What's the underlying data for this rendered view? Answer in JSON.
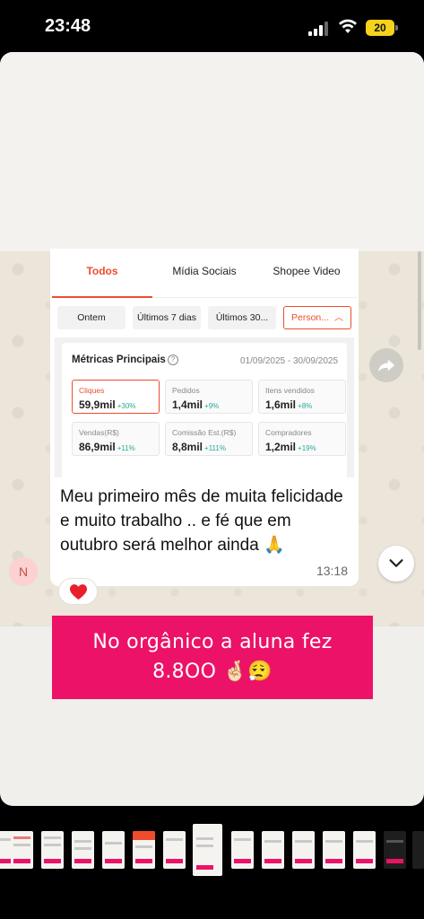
{
  "status_bar": {
    "time": "23:48",
    "battery": "20"
  },
  "shopee": {
    "tabs": [
      "Todos",
      "Mídia Sociais",
      "Shopee Video"
    ],
    "filters": [
      "Ontem",
      "Últimos 7 dias",
      "Últimos 30...",
      "Person..."
    ],
    "metrics_title": "Métricas Principais",
    "date_range": "01/09/2025 - 30/09/2025",
    "metrics": [
      {
        "label": "Cliques",
        "value": "59,9mil",
        "change": "+30%"
      },
      {
        "label": "Pedidos",
        "value": "1,4mil",
        "change": "+9%"
      },
      {
        "label": "Itens vendidos",
        "value": "1,6mil",
        "change": "+8%"
      },
      {
        "label": "Vendas(R$)",
        "value": "86,9mil",
        "change": "+11%"
      },
      {
        "label": "Comissão Est.(R$)",
        "value": "8,8mil",
        "change": "+111%"
      },
      {
        "label": "Compradores",
        "value": "1,2mil",
        "change": "+19%"
      }
    ]
  },
  "message": {
    "text": "Meu primeiro mês de muita felicidade e muito trabalho  .. e fé que em outubro será melhor ainda 🙏",
    "time": "13:18",
    "avatar_initial": "N",
    "reaction": "❤️"
  },
  "caption": {
    "line1": "No orgânico a aluna fez",
    "line2": "8.8OO 🤞🏻😮‍💨"
  },
  "colors": {
    "shopee_orange": "#ee4d2d",
    "caption_pink": "#ec1267",
    "positive_green": "#26aa99"
  },
  "icons": [
    "signal-icon",
    "wifi-icon",
    "battery-icon",
    "help-icon",
    "chevron-up-icon",
    "forward-icon",
    "chevron-down-icon"
  ]
}
